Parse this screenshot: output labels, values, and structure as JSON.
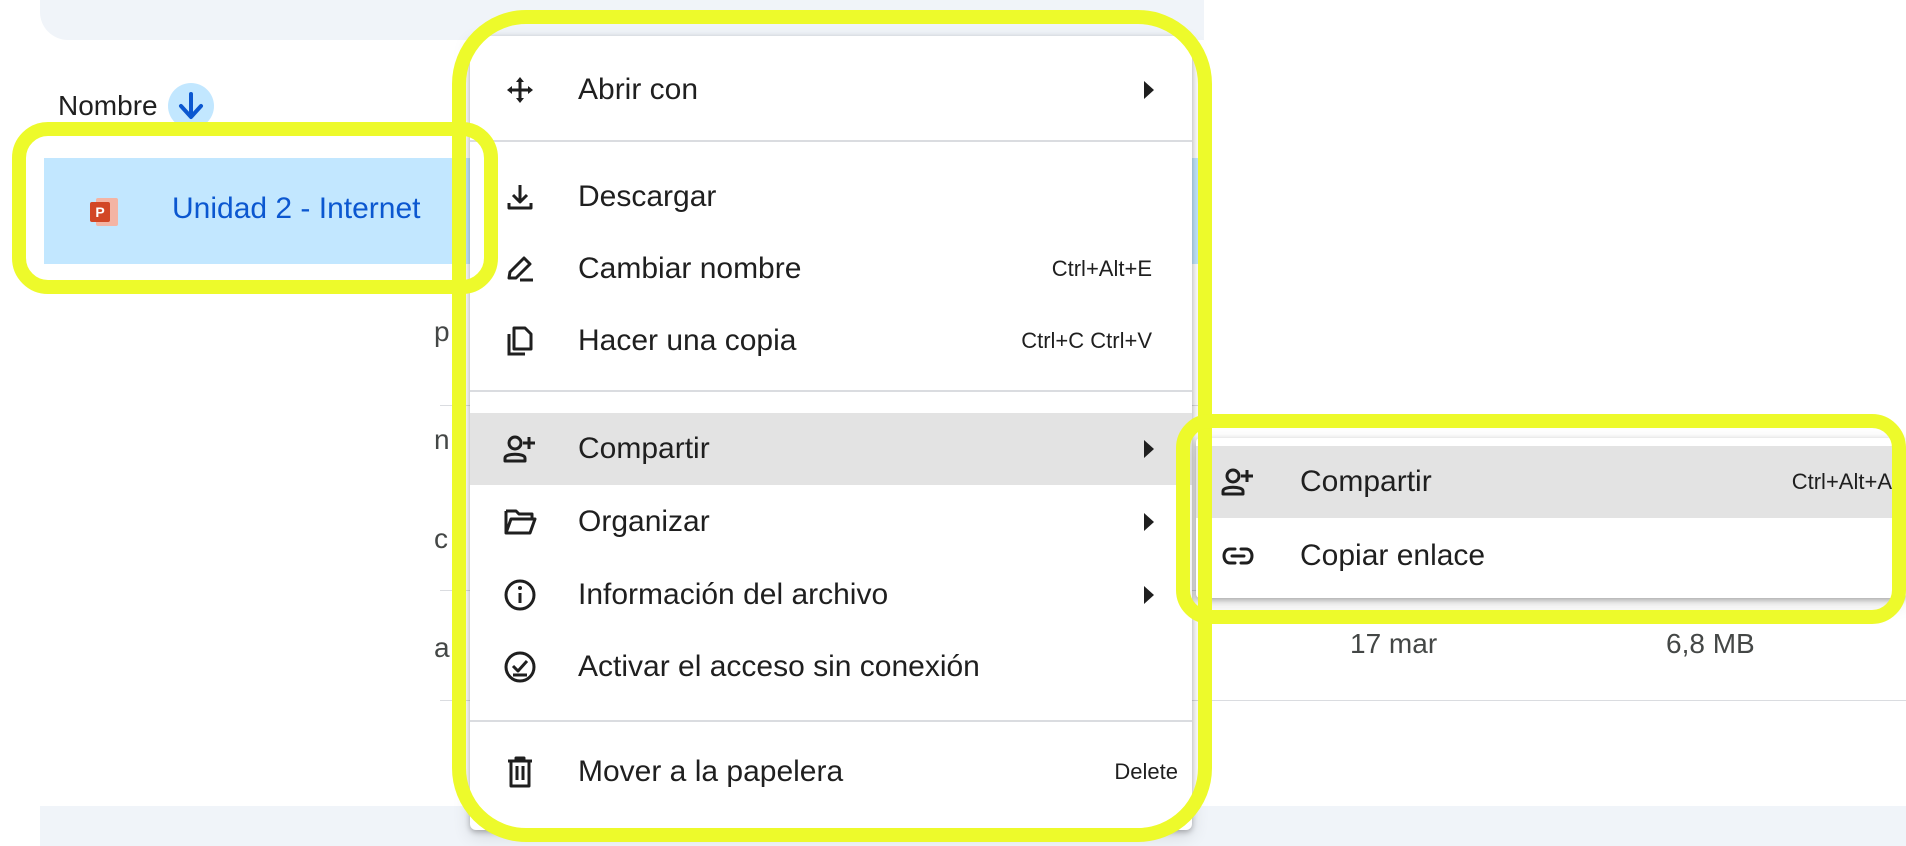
{
  "file_list": {
    "column_header": "Nombre",
    "selected_file": "Unidad 2 - Internet",
    "partial_rows": [
      "p",
      "n",
      "c",
      "a"
    ],
    "visible_row_date": "17 mar",
    "visible_row_size": "6,8 MB"
  },
  "context_menu": {
    "items": [
      {
        "label": "Abrir con",
        "icon": "open-with-icon",
        "shortcut": "",
        "submenu": true
      },
      {
        "label": "Descargar",
        "icon": "download-icon",
        "shortcut": "",
        "submenu": false
      },
      {
        "label": "Cambiar nombre",
        "icon": "rename-icon",
        "shortcut": "Ctrl+Alt+E",
        "submenu": false
      },
      {
        "label": "Hacer una copia",
        "icon": "copy-icon",
        "shortcut": "Ctrl+C Ctrl+V",
        "submenu": false
      },
      {
        "label": "Compartir",
        "icon": "share-icon",
        "shortcut": "",
        "submenu": true
      },
      {
        "label": "Organizar",
        "icon": "folder-icon",
        "shortcut": "",
        "submenu": true
      },
      {
        "label": "Información del archivo",
        "icon": "info-icon",
        "shortcut": "",
        "submenu": true
      },
      {
        "label": "Activar el acceso sin conexión",
        "icon": "offline-icon",
        "shortcut": "",
        "submenu": false
      },
      {
        "label": "Mover a la papelera",
        "icon": "trash-icon",
        "shortcut": "Delete",
        "submenu": false
      }
    ]
  },
  "share_submenu": {
    "items": [
      {
        "label": "Compartir",
        "icon": "share-icon",
        "shortcut": "Ctrl+Alt+A"
      },
      {
        "label": "Copiar enlace",
        "icon": "link-icon",
        "shortcut": ""
      }
    ]
  },
  "colors": {
    "highlight_outline": "#edfa2b",
    "selected_row": "#c2e7ff",
    "file_link": "#0b57d0",
    "hover_item": "#e3e3e3",
    "ppt_icon": "#d24726"
  }
}
